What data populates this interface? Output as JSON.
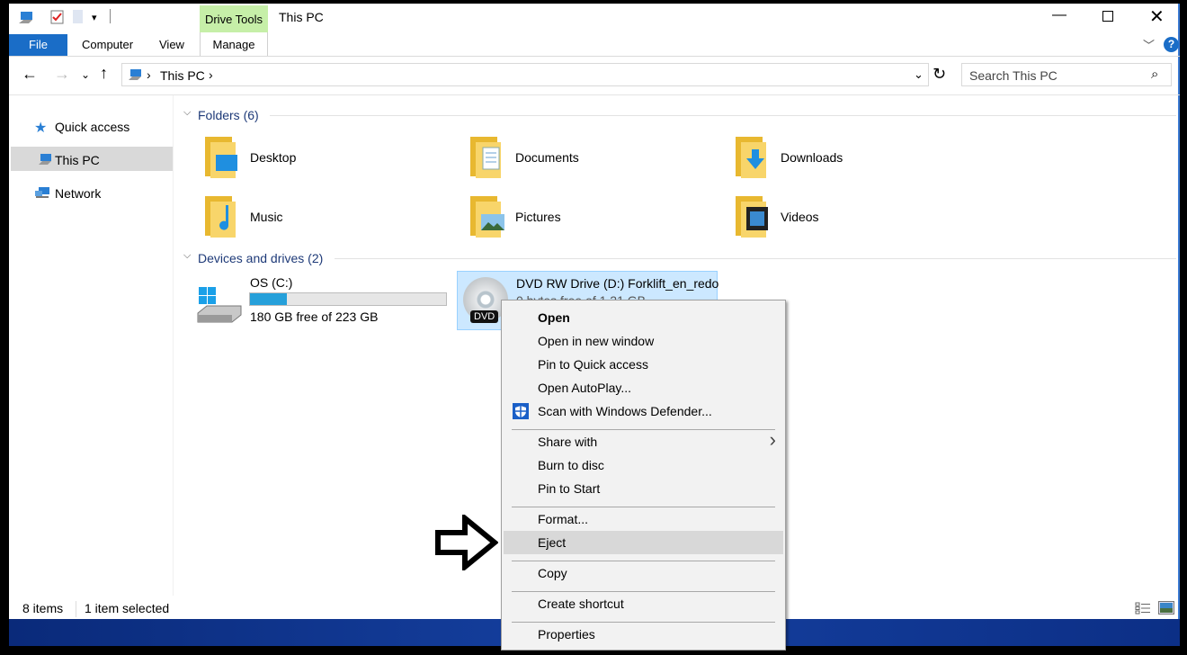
{
  "titlebar": {
    "title": "This PC",
    "context_tab": "Drive Tools",
    "controls": [
      "minimize-icon",
      "maximize-icon",
      "close-icon"
    ]
  },
  "ribbon": {
    "tabs": [
      "File",
      "Computer",
      "View",
      "Manage"
    ]
  },
  "address": {
    "path": [
      "This PC"
    ],
    "search_placeholder": "Search This PC"
  },
  "sidebar": {
    "items": [
      {
        "label": "Quick access",
        "icon": "star-icon"
      },
      {
        "label": "This PC",
        "icon": "computer-icon",
        "selected": true
      },
      {
        "label": "Network",
        "icon": "network-icon"
      }
    ]
  },
  "folders": {
    "header": "Folders (6)",
    "items": [
      {
        "label": "Desktop",
        "icon": "desktop-folder-icon"
      },
      {
        "label": "Documents",
        "icon": "documents-folder-icon"
      },
      {
        "label": "Downloads",
        "icon": "downloads-folder-icon"
      },
      {
        "label": "Music",
        "icon": "music-folder-icon"
      },
      {
        "label": "Pictures",
        "icon": "pictures-folder-icon"
      },
      {
        "label": "Videos",
        "icon": "videos-folder-icon"
      }
    ]
  },
  "drives": {
    "header": "Devices and drives (2)",
    "items": [
      {
        "name": "OS (C:)",
        "free": "180 GB free of 223 GB",
        "used_percent": 19
      },
      {
        "name": "DVD RW Drive (D:) Forklift_en_redo",
        "free": "0 bytes free of 1.21 GB",
        "badge": "DVD",
        "selected": true
      }
    ]
  },
  "context_menu": {
    "items": [
      {
        "label": "Open",
        "bold": true
      },
      {
        "label": "Open in new window"
      },
      {
        "label": "Pin to Quick access"
      },
      {
        "label": "Open AutoPlay..."
      },
      {
        "label": "Scan with Windows Defender...",
        "icon": "windows-defender-icon"
      },
      {
        "sep": true
      },
      {
        "label": "Share with",
        "submenu": true
      },
      {
        "label": "Burn to disc"
      },
      {
        "label": "Pin to Start"
      },
      {
        "sep": true
      },
      {
        "label": "Format..."
      },
      {
        "label": "Eject",
        "highlighted": true
      },
      {
        "sep": true
      },
      {
        "label": "Copy"
      },
      {
        "sep": true
      },
      {
        "label": "Create shortcut"
      },
      {
        "sep": true
      },
      {
        "label": "Properties"
      }
    ]
  },
  "status": {
    "count": "8 items",
    "selected": "1 item selected"
  },
  "colors": {
    "accent": "#1a6dc7",
    "drive_tools": "#c6efa8",
    "selection": "#cce8ff",
    "progress": "#26a0da"
  }
}
